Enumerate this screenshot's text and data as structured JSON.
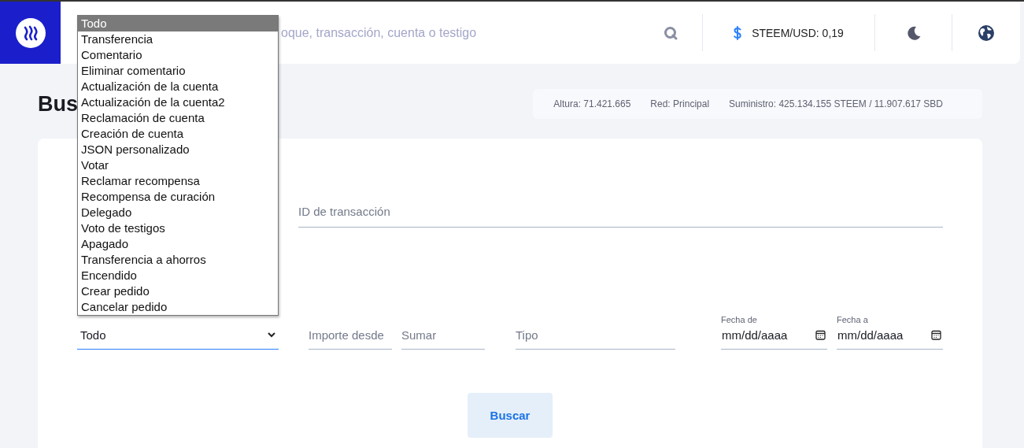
{
  "header": {
    "search": {
      "placeholder": "oque, transacción, cuenta o testigo"
    },
    "price": "STEEM/USD: 0,19"
  },
  "page_title": "Bus",
  "stats": [
    "Altura: 71.421.665",
    "Red: Principal",
    "Suministro: 425.134.155 STEEM / 11.907.617 SBD"
  ],
  "form": {
    "transaction_id": {
      "placeholder": "ID de transacción"
    },
    "type_select": {
      "value": "Todo",
      "open": true,
      "options": [
        {
          "label": "Todo",
          "selected": true
        },
        {
          "label": "Transferencia",
          "selected": false
        },
        {
          "label": "Comentario",
          "selected": false
        },
        {
          "label": "Eliminar comentario",
          "selected": false
        },
        {
          "label": "Actualización de la cuenta",
          "selected": false
        },
        {
          "label": "Actualización de la cuenta2",
          "selected": false
        },
        {
          "label": "Reclamación de cuenta",
          "selected": false
        },
        {
          "label": "Creación de cuenta",
          "selected": false
        },
        {
          "label": "JSON personalizado",
          "selected": false
        },
        {
          "label": "Votar",
          "selected": false
        },
        {
          "label": "Reclamar recompensa",
          "selected": false
        },
        {
          "label": "Recompensa de curación",
          "selected": false
        },
        {
          "label": "Delegado",
          "selected": false
        },
        {
          "label": "Voto de testigos",
          "selected": false
        },
        {
          "label": "Apagado",
          "selected": false
        },
        {
          "label": "Transferencia a ahorros",
          "selected": false
        },
        {
          "label": "Encendido",
          "selected": false
        },
        {
          "label": "Crear pedido",
          "selected": false
        },
        {
          "label": "Cancelar pedido",
          "selected": false
        }
      ]
    },
    "amount_from": {
      "placeholder": "Importe desde"
    },
    "amount_to": {
      "placeholder": "Sumar"
    },
    "kind": {
      "placeholder": "Tipo"
    },
    "date_from": {
      "label": "Fecha de",
      "placeholder": "mm/dd/aaaa"
    },
    "date_to": {
      "label": "Fecha a",
      "placeholder": "mm/dd/aaaa"
    },
    "button": "Buscar"
  }
}
